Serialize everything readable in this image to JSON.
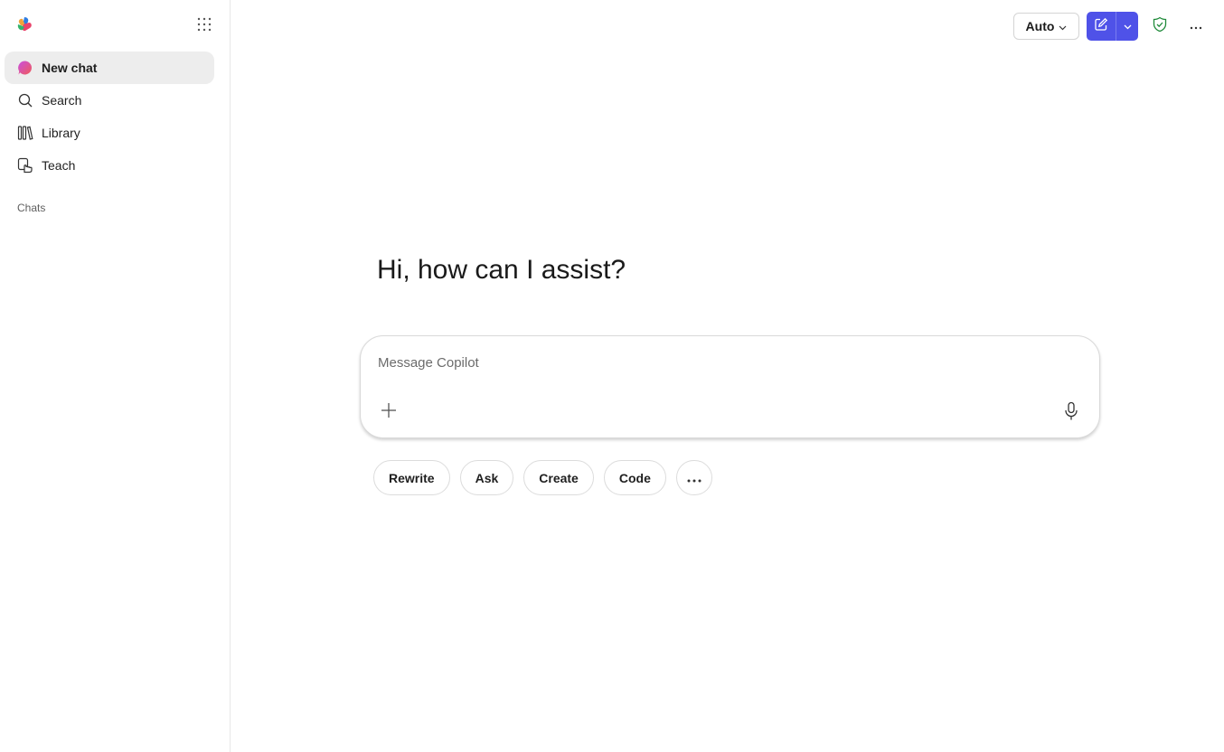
{
  "sidebar": {
    "items": [
      {
        "label": "New chat",
        "icon": "new-chat-icon",
        "active": true
      },
      {
        "label": "Search",
        "icon": "search-icon"
      },
      {
        "label": "Library",
        "icon": "library-icon"
      },
      {
        "label": "Teach",
        "icon": "teach-icon"
      }
    ],
    "section_label": "Chats"
  },
  "topbar": {
    "mode_label": "Auto",
    "accent": "#4f52e8",
    "shield_color": "#1f8a3a"
  },
  "main": {
    "greeting": "Hi, how can I assist?",
    "composer": {
      "placeholder": "Message Copilot",
      "value": ""
    },
    "chips": [
      "Rewrite",
      "Ask",
      "Create",
      "Code"
    ]
  }
}
